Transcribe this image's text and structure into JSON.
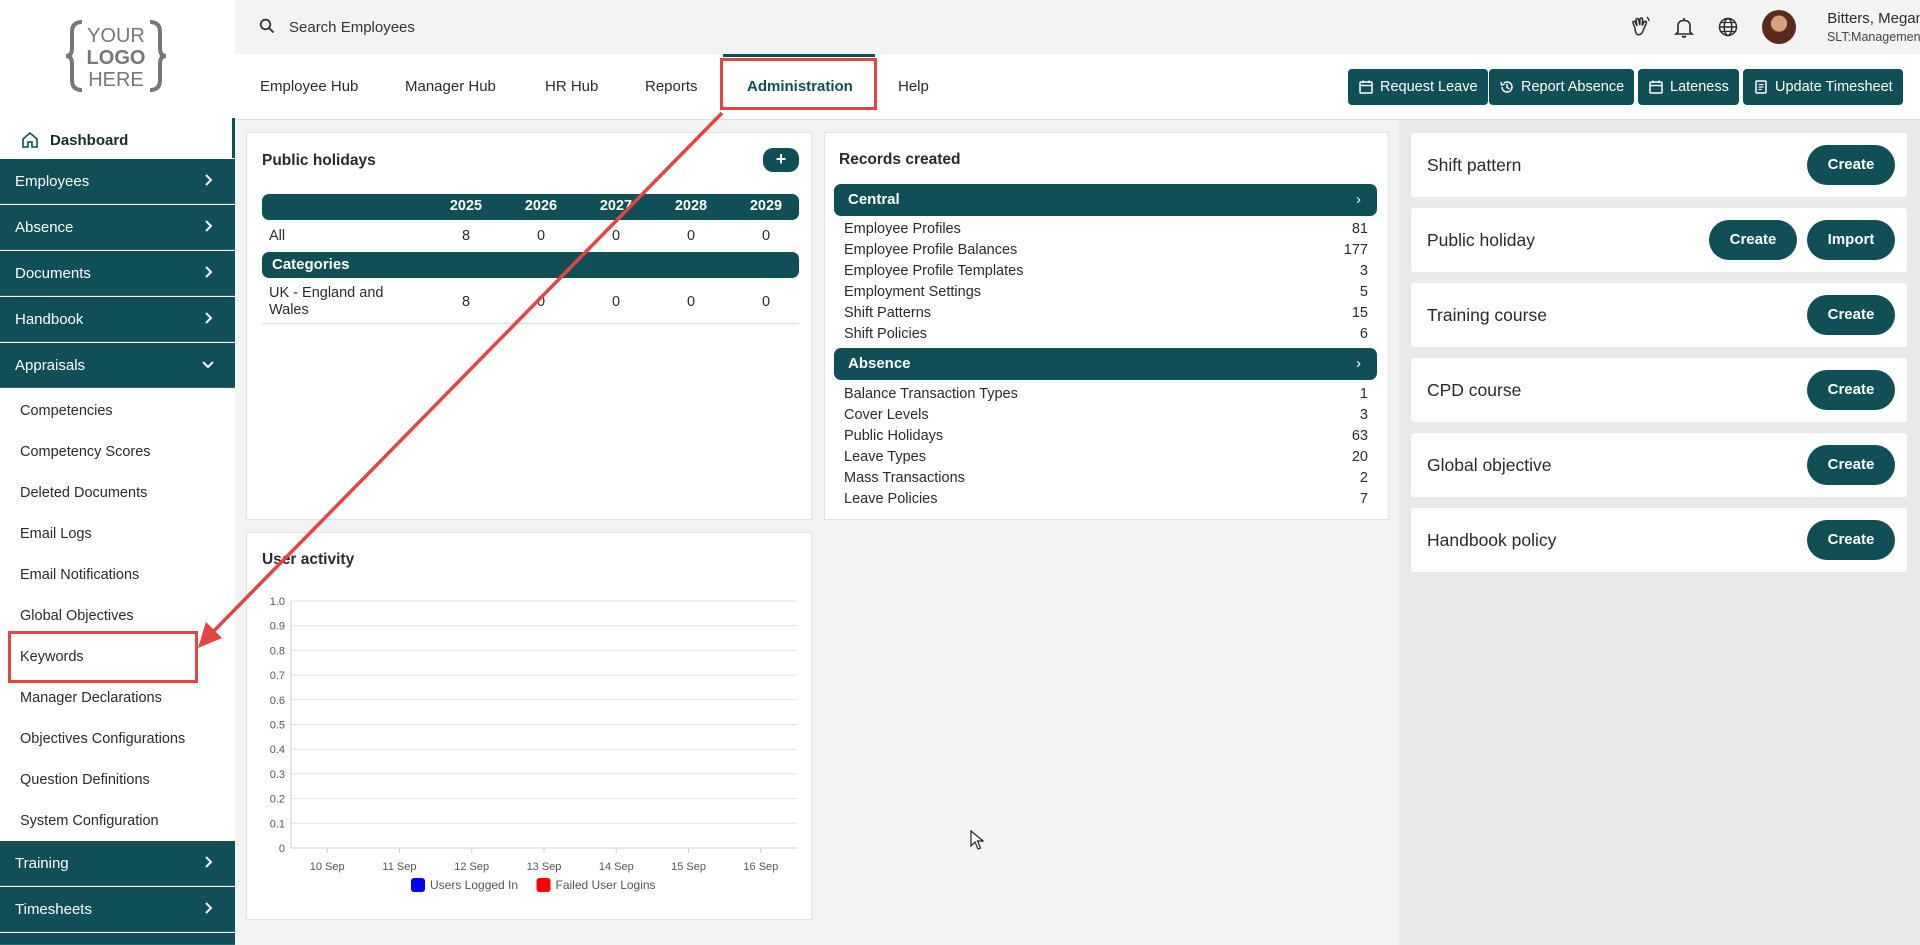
{
  "logo": {
    "lines": [
      "YOUR",
      "LOGO",
      "HERE"
    ]
  },
  "search": {
    "placeholder": "Search Employees"
  },
  "user": {
    "name": "Bitters, Megan",
    "role": "SLT:Management"
  },
  "menu": {
    "items": [
      "Employee Hub",
      "Manager Hub",
      "HR Hub",
      "Reports",
      "Administration",
      "Help"
    ],
    "active": "Administration"
  },
  "actions": [
    "Request Leave",
    "Report Absence",
    "Lateness",
    "Update Timesheet"
  ],
  "sidebar": {
    "dashboard": "Dashboard",
    "sections": [
      "Employees",
      "Absence",
      "Documents",
      "Handbook",
      "Appraisals"
    ],
    "appraisal_items": [
      "Competencies",
      "Competency Scores",
      "Deleted Documents",
      "Email Logs",
      "Email Notifications",
      "Global Objectives",
      "Keywords",
      "Manager Declarations",
      "Objectives Configurations",
      "Question Definitions",
      "System Configuration"
    ],
    "bottom_sections": [
      "Training",
      "Timesheets"
    ]
  },
  "public_holidays": {
    "title": "Public holidays",
    "add": "+",
    "years": [
      "2025",
      "2026",
      "2027",
      "2028",
      "2029"
    ],
    "all_label": "All",
    "all_values": [
      "8",
      "0",
      "0",
      "0",
      "0"
    ],
    "categories_label": "Categories",
    "category_rows": [
      {
        "label": "UK - England and Wales",
        "values": [
          "8",
          "0",
          "0",
          "0",
          "0"
        ]
      }
    ]
  },
  "records": {
    "title": "Records created",
    "groups": [
      {
        "name": "Central",
        "rows": [
          {
            "label": "Employee Profiles",
            "value": "81"
          },
          {
            "label": "Employee Profile Balances",
            "value": "177"
          },
          {
            "label": "Employee Profile Templates",
            "value": "3"
          },
          {
            "label": "Employment Settings",
            "value": "5"
          },
          {
            "label": "Shift Patterns",
            "value": "15"
          },
          {
            "label": "Shift Policies",
            "value": "6"
          }
        ]
      },
      {
        "name": "Absence",
        "rows": [
          {
            "label": "Balance Transaction Types",
            "value": "1"
          },
          {
            "label": "Cover Levels",
            "value": "3"
          },
          {
            "label": "Public Holidays",
            "value": "63"
          },
          {
            "label": "Leave Types",
            "value": "20"
          },
          {
            "label": "Mass Transactions",
            "value": "2"
          },
          {
            "label": "Leave Policies",
            "value": "7"
          }
        ]
      }
    ]
  },
  "user_activity": {
    "title": "User activity"
  },
  "chart_data": {
    "type": "line",
    "title": "User activity",
    "categories": [
      "10 Sep",
      "11 Sep",
      "12 Sep",
      "13 Sep",
      "14 Sep",
      "15 Sep",
      "16 Sep"
    ],
    "yticks": [
      "0",
      "0.1",
      "0.2",
      "0.3",
      "0.4",
      "0.5",
      "0.6",
      "0.7",
      "0.8",
      "0.9",
      "1.0"
    ],
    "ylim": [
      0,
      1
    ],
    "series": [
      {
        "name": "Users Logged In",
        "color": "#0000ff",
        "values": []
      },
      {
        "name": "Failed User Logins",
        "color": "#ff0000",
        "values": []
      }
    ],
    "legend": "bottom",
    "grid": true
  },
  "quick_create": [
    {
      "label": "Shift pattern",
      "buttons": [
        "Create"
      ]
    },
    {
      "label": "Public holiday",
      "buttons": [
        "Create",
        "Import"
      ]
    },
    {
      "label": "Training course",
      "buttons": [
        "Create"
      ]
    },
    {
      "label": "CPD course",
      "buttons": [
        "Create"
      ]
    },
    {
      "label": "Global objective",
      "buttons": [
        "Create"
      ]
    },
    {
      "label": "Handbook policy",
      "buttons": [
        "Create"
      ]
    }
  ],
  "colors": {
    "primary": "#0f4f55",
    "annotation": "#e34444"
  }
}
